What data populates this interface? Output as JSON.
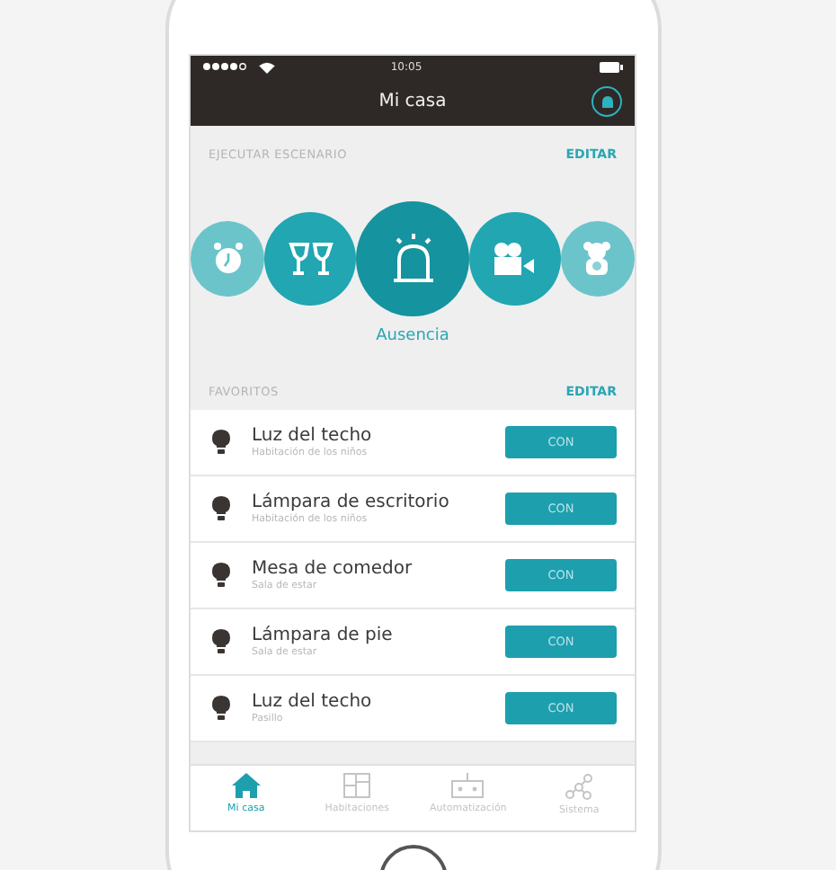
{
  "status_bar": {
    "time": "10:05"
  },
  "header": {
    "title": "Mi casa"
  },
  "scenes_section": {
    "title": "EJECUTAR ESCENARIO",
    "action": "EDITAR",
    "scenes": [
      {
        "kind": "clock",
        "selected": false
      },
      {
        "kind": "toast",
        "selected": false
      },
      {
        "kind": "siren",
        "selected": true
      },
      {
        "kind": "camera",
        "selected": false
      },
      {
        "kind": "teddy",
        "selected": false
      }
    ],
    "active_label": "Ausencia"
  },
  "favorites_section": {
    "title": "FAVORITOS",
    "action": "EDITAR",
    "items": [
      {
        "name": "Luz del techo",
        "room": "Habitación de los niños",
        "button": "CON"
      },
      {
        "name": "Lámpara de escritorio",
        "room": "Habitación de los niños",
        "button": "CON"
      },
      {
        "name": "Mesa de comedor",
        "room": "Sala de estar",
        "button": "CON"
      },
      {
        "name": "Lámpara de pie",
        "room": "Sala de estar",
        "button": "CON"
      },
      {
        "name": "Luz del techo",
        "room": "Pasillo",
        "button": "CON"
      }
    ]
  },
  "tabs": [
    {
      "label": "Mi casa",
      "kind": "home",
      "selected": true
    },
    {
      "label": "Habitaciones",
      "kind": "rooms",
      "selected": false
    },
    {
      "label": "Automatización",
      "kind": "robot",
      "selected": false
    },
    {
      "label": "Sistema",
      "kind": "network",
      "selected": false
    }
  ]
}
